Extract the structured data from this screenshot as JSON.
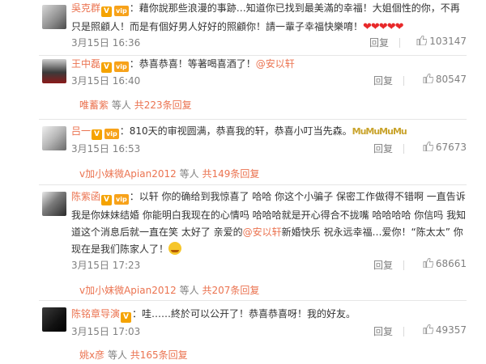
{
  "colors": {
    "accent": "#eb7350",
    "meta": "#808080",
    "divider": "#e6e6e6",
    "heart": "#e8292a"
  },
  "comments": [
    {
      "username": "吳克群",
      "sep": "：",
      "text_a": "藉你說那些浪漫的事跡…知道你已找到最美滿的幸福！大姐個性的你，不再只是照顧人！而是有個好男人好好的照顧你！請一輩子幸福快樂唷！",
      "hearts": "❤❤❤❤❤",
      "timestamp": "3月15日 16:36",
      "reply_label": "回复",
      "likes": "103147"
    },
    {
      "username": "王中磊",
      "sep": "：",
      "text_a": "恭喜恭喜！等著喝喜酒了！",
      "mention": "@安以轩",
      "timestamp": "3月15日 16:40",
      "reply_label": "回复",
      "likes": "80547",
      "sub_who": "唯蓄紫",
      "sub_mid": "等人",
      "sub_count": "共223条回复"
    },
    {
      "username": "吕一",
      "sep": "：",
      "text_a": "810天的审视圆满，恭喜我的轩，恭喜小叮当先森。",
      "mm": "MuMuMuMu",
      "timestamp": "3月15日 16:53",
      "reply_label": "回复",
      "likes": "67673",
      "sub_who": "v加小妹微Apian2012",
      "sub_mid": "等人",
      "sub_count": "共149条回复"
    },
    {
      "username": "陈紫函",
      "sep": "：",
      "text_a": "以轩 你的确给到我惊喜了 哈哈 你这个小骗子 保密工作做得不错啊 一直告诉我是你妹妹结婚 你能明白我现在的心情吗 哈哈哈就是开心得合不拢嘴 哈哈哈哈 你信吗 我知道这个消息后就一直在笑 太好了 亲爱的",
      "mention": "@安以轩",
      "text_b": "新婚快乐 祝永远幸福…爱你！“陈太太” 你现在是我们陈家人了！",
      "timestamp": "3月15日 17:23",
      "reply_label": "回复",
      "likes": "68661",
      "sub_who": "v加小妹微Apian2012",
      "sub_mid": "等人",
      "sub_count": "共207条回复"
    },
    {
      "username": "陈铭章导演",
      "sep": "：",
      "text_a": "哇……終於可以公开了！恭喜恭喜呀！我的好友。",
      "timestamp": "3月15日 17:03",
      "reply_label": "回复",
      "likes": "49357",
      "sub_who": "姚x彦",
      "sub_mid": "等人",
      "sub_count": "共165条回复"
    }
  ]
}
